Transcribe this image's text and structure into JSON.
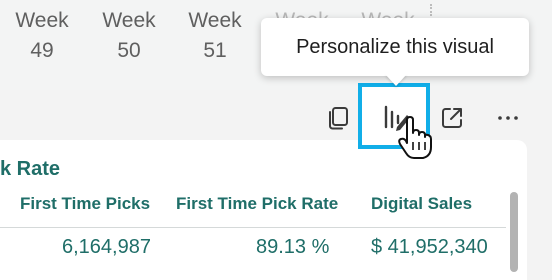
{
  "weeks": [
    {
      "label": "Week",
      "num": "49"
    },
    {
      "label": "Week",
      "num": "50"
    },
    {
      "label": "Week",
      "num": "51"
    },
    {
      "label": "Week",
      "num": ""
    },
    {
      "label": "Week",
      "num": ""
    }
  ],
  "tooltip": {
    "text": "Personalize this visual"
  },
  "toolbar": {
    "icons": [
      "copy-icon",
      "personalize-visual-icon",
      "focus-mode-icon",
      "more-options-icon"
    ],
    "more_label": "..."
  },
  "table": {
    "title": "k Rate",
    "columns": [
      "First Time Picks",
      "First Time Pick Rate",
      "Digital Sales"
    ],
    "rows": [
      [
        "6,164,987",
        "89.13 %",
        "$ 41,952,340"
      ]
    ]
  },
  "colors": {
    "accent": "#11aee8",
    "table_text": "#1f6e68",
    "week_text": "#5f5f5f"
  }
}
